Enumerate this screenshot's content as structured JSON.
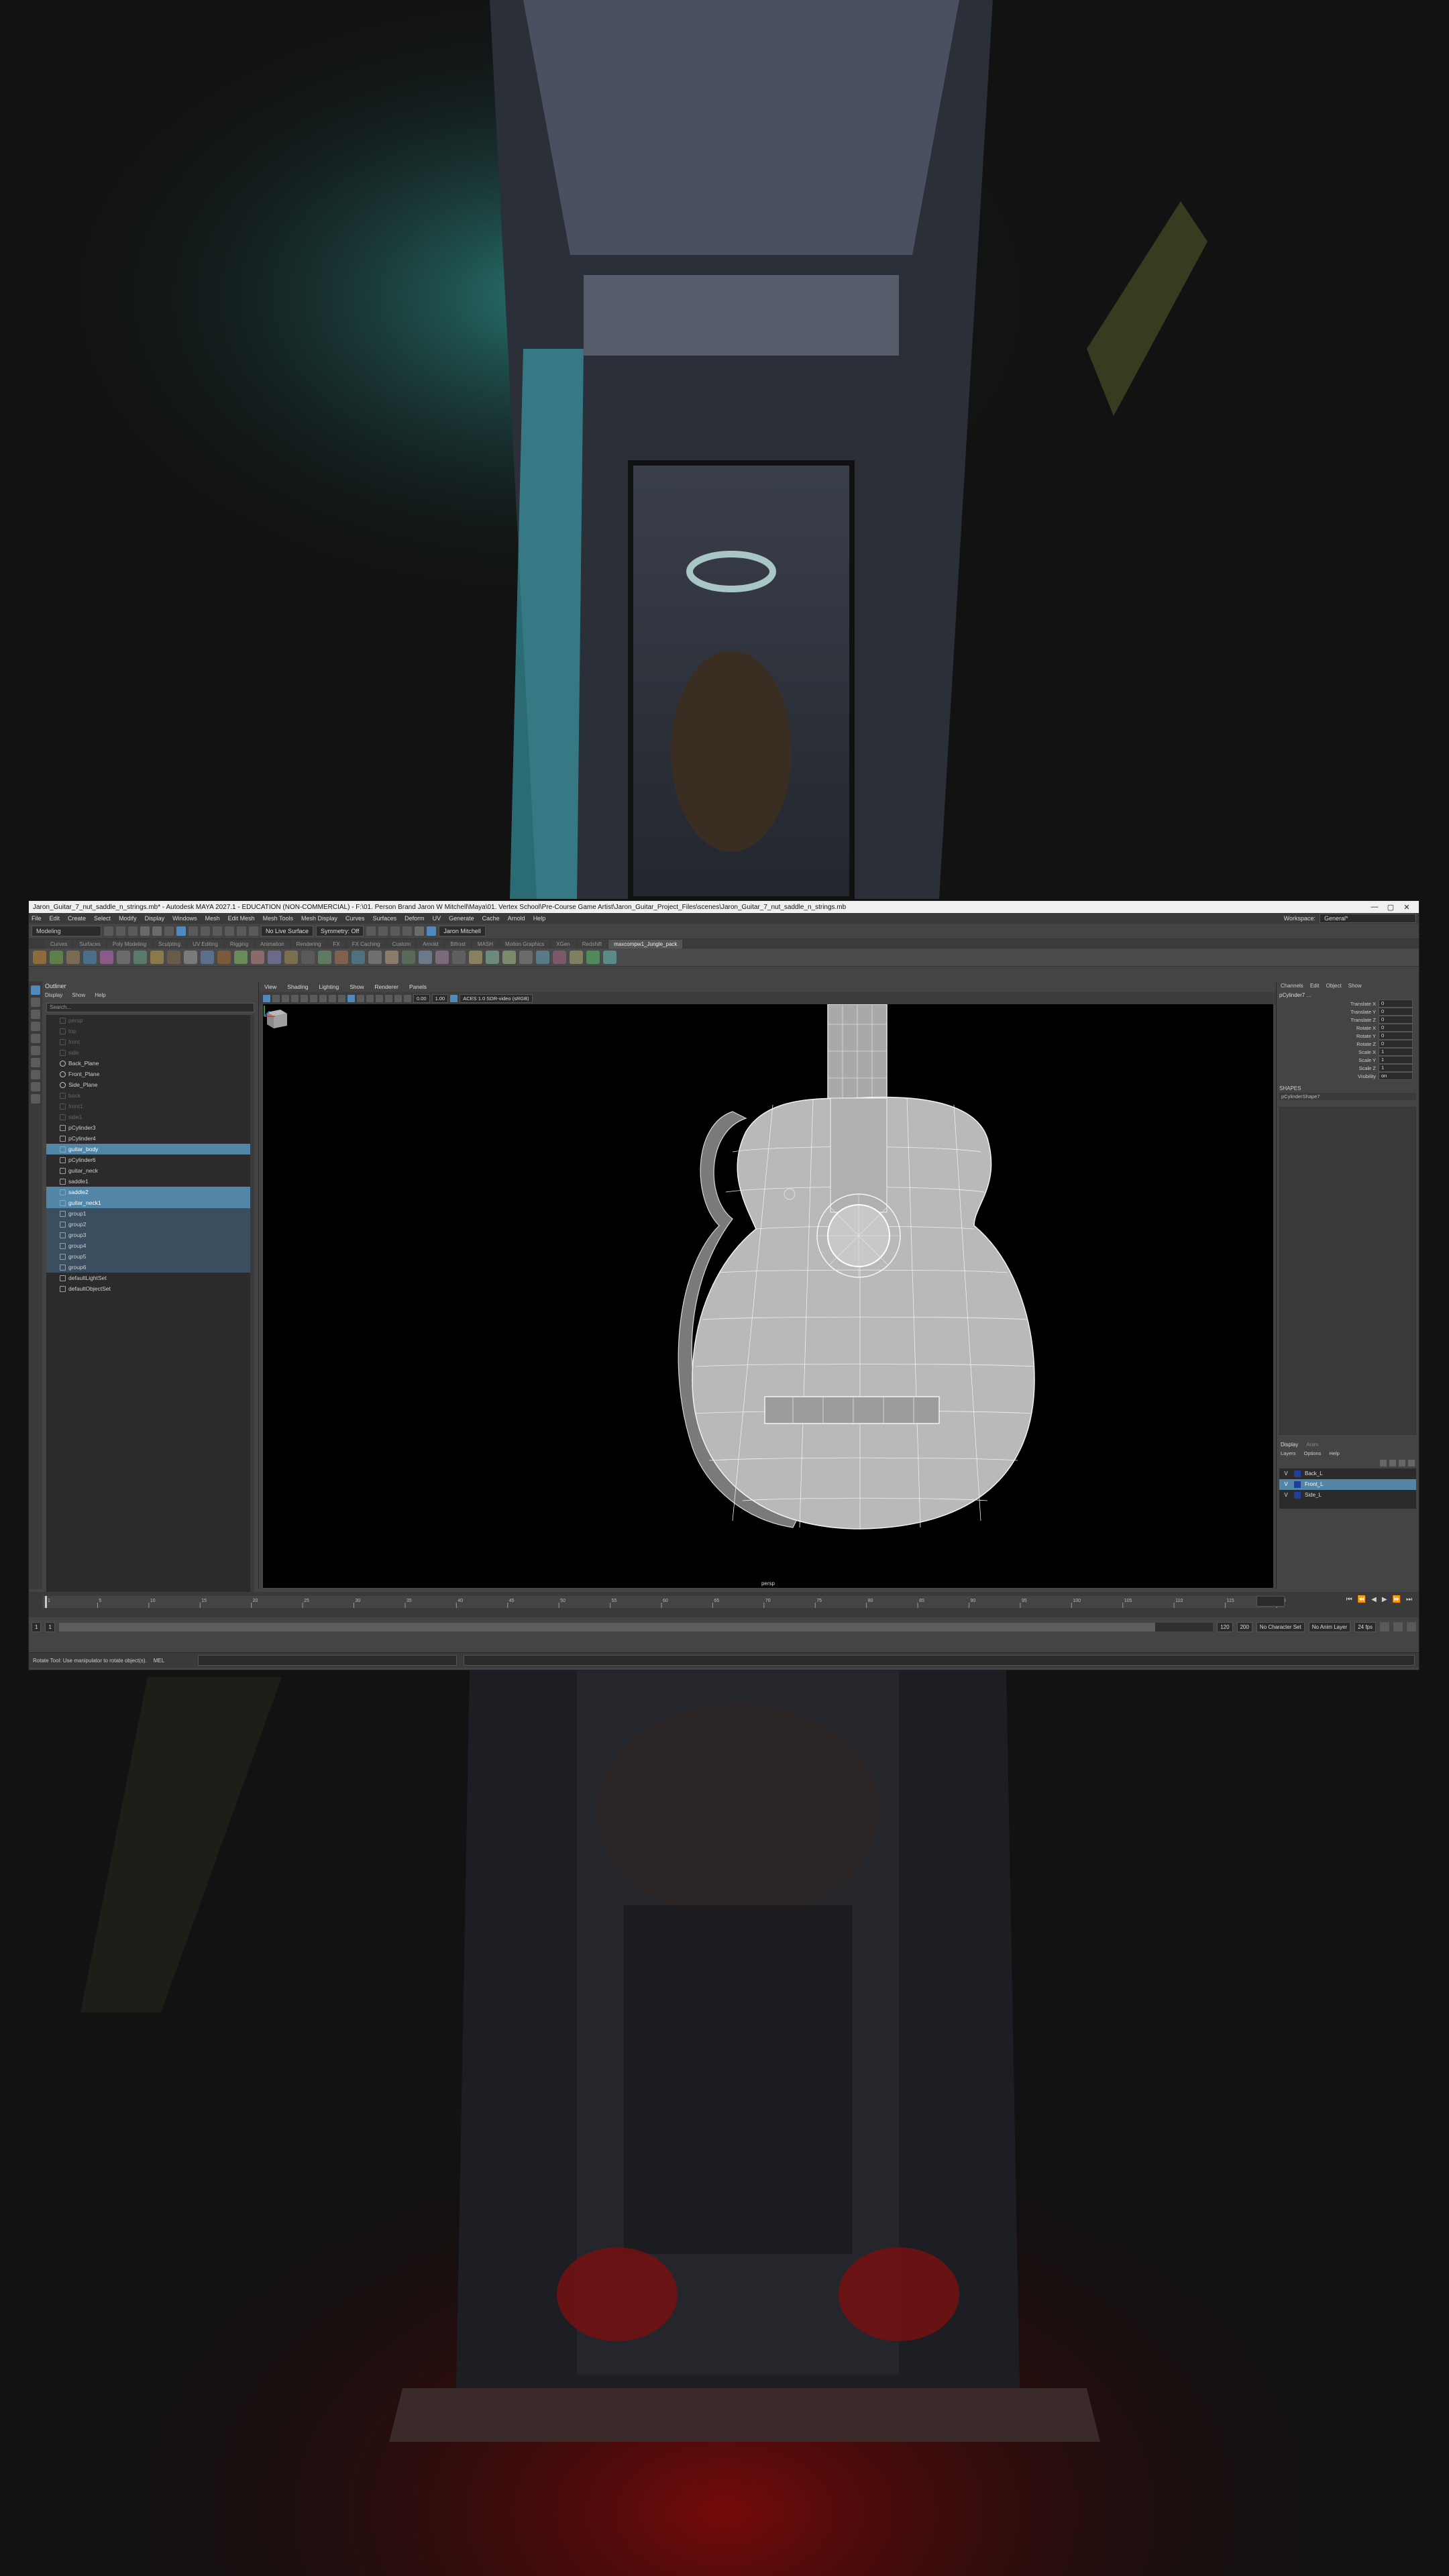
{
  "window": {
    "title": "Jaron_Guitar_7_nut_saddle_n_strings.mb* - Autodesk MAYA 2027.1 - EDUCATION (NON-COMMERCIAL) - F:\\01. Person Brand Jaron W Mitchell\\Maya\\01. Vertex School\\Pre-Course Game Artist\\Jaron_Guitar_Project_Files\\scenes\\Jaron_Guitar_7_nut_saddle_n_strings.mb",
    "min": "—",
    "max": "▢",
    "close": "✕"
  },
  "menubar": {
    "items": [
      "File",
      "Edit",
      "Create",
      "Select",
      "Modify",
      "Display",
      "Windows",
      "Mesh",
      "Edit Mesh",
      "Mesh Tools",
      "Mesh Display",
      "Curves",
      "Surfaces",
      "Deform",
      "UV",
      "Generate",
      "Cache",
      "Arnold",
      "Help"
    ],
    "workspace_label": "Workspace:",
    "workspace_value": "General*"
  },
  "statusline": {
    "mode": "Modeling",
    "no_live": "No Live Surface",
    "symmetry": "Symmetry: Off",
    "user": "Jaron Mitchell"
  },
  "shelf": {
    "tabs": [
      "Curves",
      "Surfaces",
      "Poly Modeling",
      "Sculpting",
      "UV Editing",
      "Rigging",
      "Animation",
      "Rendering",
      "FX",
      "FX Caching",
      "Custom",
      "Arnold",
      "Bifrost",
      "MASH",
      "Motion Graphics",
      "XGen",
      "Redshift",
      "maxcompw1_Jungle_pack"
    ],
    "active_tab": "maxcompw1_Jungle_pack"
  },
  "outliner": {
    "title": "Outliner",
    "menu": [
      "Display",
      "Show",
      "Help"
    ],
    "search_placeholder": "Search...",
    "rows": [
      {
        "label": "persp",
        "state": "dim"
      },
      {
        "label": "top",
        "state": "dim"
      },
      {
        "label": "front",
        "state": "dim"
      },
      {
        "label": "side",
        "state": "dim"
      },
      {
        "label": "Back_Plane",
        "state": "cam"
      },
      {
        "label": "Front_Plane",
        "state": "cam"
      },
      {
        "label": "Side_Plane",
        "state": "cam"
      },
      {
        "label": "back",
        "state": "dim"
      },
      {
        "label": "front1",
        "state": "dim"
      },
      {
        "label": "side1",
        "state": "dim"
      },
      {
        "label": "pCylinder3",
        "state": "normal"
      },
      {
        "label": "pCylinder4",
        "state": "normal"
      },
      {
        "label": "guitar_body",
        "state": "sel"
      },
      {
        "label": "pCylinder6",
        "state": "normal"
      },
      {
        "label": "guitar_neck",
        "state": "normal"
      },
      {
        "label": "saddle1",
        "state": "normal"
      },
      {
        "label": "saddle2",
        "state": "sel"
      },
      {
        "label": "guitar_neck1",
        "state": "sel"
      },
      {
        "label": "group1",
        "state": "sub"
      },
      {
        "label": "group2",
        "state": "sub"
      },
      {
        "label": "group3",
        "state": "sub"
      },
      {
        "label": "group4",
        "state": "sub"
      },
      {
        "label": "group5",
        "state": "sub"
      },
      {
        "label": "group6",
        "state": "sub"
      },
      {
        "label": "defaultLightSet",
        "state": "normal"
      },
      {
        "label": "defaultObjectSet",
        "state": "normal"
      }
    ]
  },
  "viewport": {
    "menu": [
      "View",
      "Shading",
      "Lighting",
      "Show",
      "Renderer",
      "Panels"
    ],
    "num1": "0.00",
    "num2": "1.00",
    "colorspace": "ACES 1.0 SDR-video (sRGB)",
    "camera_label": "persp"
  },
  "channelbox": {
    "tabs": [
      "Channels",
      "Edit",
      "Object",
      "Show"
    ],
    "object_name": "pCylinder7 ...",
    "attributes": [
      {
        "label": "Translate X",
        "value": "0"
      },
      {
        "label": "Translate Y",
        "value": "0"
      },
      {
        "label": "Translate Z",
        "value": "0"
      },
      {
        "label": "Rotate X",
        "value": "0"
      },
      {
        "label": "Rotate Y",
        "value": "0"
      },
      {
        "label": "Rotate Z",
        "value": "0"
      },
      {
        "label": "Scale X",
        "value": "1"
      },
      {
        "label": "Scale Y",
        "value": "1"
      },
      {
        "label": "Scale Z",
        "value": "1"
      },
      {
        "label": "Visibility",
        "value": "on"
      }
    ],
    "shapes_header": "SHAPES",
    "shape_name": "pCylinderShape7"
  },
  "layers": {
    "tabs": [
      "Display",
      "Anim"
    ],
    "menu": [
      "Layers",
      "Options",
      "Help"
    ],
    "rows": [
      {
        "label": "Back_L",
        "v": "V",
        "color": "#1f3f9a"
      },
      {
        "label": "Front_L",
        "v": "V",
        "color": "#1f3f9a"
      },
      {
        "label": "Side_L",
        "v": "V",
        "color": "#1f3f9a"
      }
    ],
    "selected_index": 1
  },
  "timeslider": {
    "ticks": [
      "1",
      "5",
      "10",
      "15",
      "20",
      "25",
      "30",
      "35",
      "40",
      "45",
      "50",
      "55",
      "60",
      "65",
      "70",
      "75",
      "80",
      "85",
      "90",
      "95",
      "100",
      "105",
      "110",
      "115",
      "120"
    ],
    "current_frame": "1"
  },
  "rangeslider": {
    "start": "1",
    "range_start": "1",
    "range_end": "120",
    "end": "200",
    "char_set": "No Character Set",
    "anim_layer": "No Anim Layer",
    "fps": "24 fps"
  },
  "helpline": {
    "text": "Rotate Tool: Use manipulator to rotate object(s).",
    "cmd_label": "MEL"
  },
  "colors": {
    "selection": "#5285a6",
    "maya_bg": "#444444",
    "viewport_bg": "#000000"
  }
}
